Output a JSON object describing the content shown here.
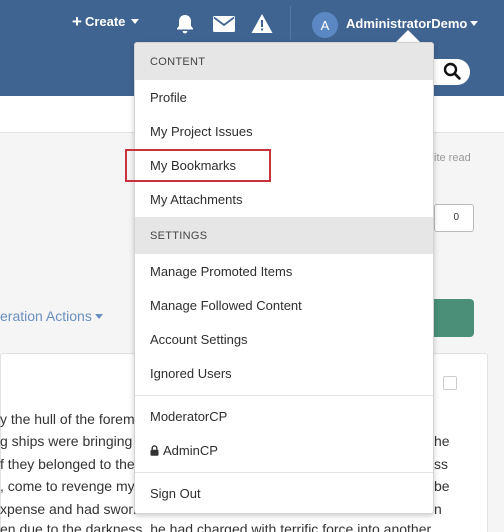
{
  "header": {
    "create_label": "Create",
    "avatar_letter": "A",
    "username": "AdministratorDemo"
  },
  "background": {
    "site_read": "ite read",
    "count_value": "0",
    "moderation_actions": "eration Actions",
    "post_lines": [
      "y the hull of the foremo",
      "g ships were bringing h",
      "f they belonged to the",
      ", come to revenge my",
      "xpense and had sworn",
      "en due to the darkness, he had charged with terrific force into another"
    ],
    "post_lines_right": [
      "he",
      "ss",
      "be",
      "n"
    ]
  },
  "dropdown": {
    "content_header": "CONTENT",
    "content_items": [
      {
        "label": "Profile"
      },
      {
        "label": "My Project Issues"
      },
      {
        "label": "My Bookmarks"
      },
      {
        "label": "My Attachments"
      }
    ],
    "settings_header": "SETTINGS",
    "settings_items": [
      {
        "label": "Manage Promoted Items"
      },
      {
        "label": "Manage Followed Content"
      },
      {
        "label": "Account Settings"
      },
      {
        "label": "Ignored Users"
      }
    ],
    "moderator_cp": "ModeratorCP",
    "admin_cp": "AdminCP",
    "sign_out": "Sign Out"
  }
}
